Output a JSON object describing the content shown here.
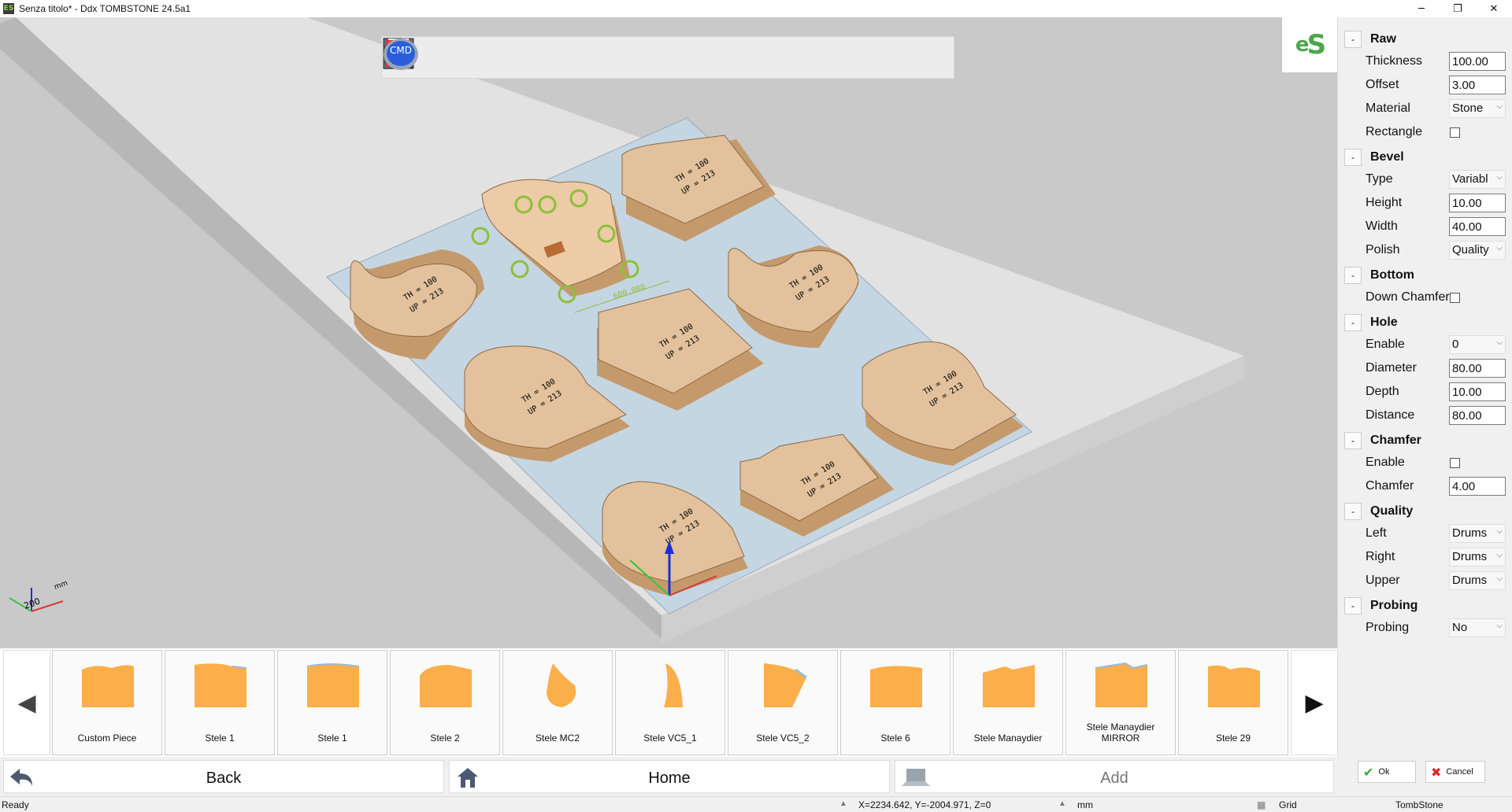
{
  "window": {
    "title": "Senza titolo* - Ddx TOMBSTONE 24.5a1",
    "app_icon": "ES",
    "minimize": "─",
    "restore": "❐",
    "close": "✕"
  },
  "toolbar": {
    "icons": [
      "new-file-icon",
      "open-folder-icon",
      "save-icon",
      "zoom-window-icon",
      "zoom-all-icon",
      "zoom-in-icon",
      "zoom-out-icon",
      "fit-view-icon",
      "rotate-view-icon",
      "view-3d-icon",
      "wireframe-icon",
      "solid-icon",
      "cmd-icon"
    ],
    "cmd_label": "CMD"
  },
  "logo": {
    "text_e": "e",
    "text_s": "S"
  },
  "viewport": {
    "axis_unit": "mm",
    "axis_value": "200",
    "pieces": [
      {
        "line1": "TH = 100",
        "line2": "UP = 213"
      },
      {
        "line1": "TH = 100",
        "line2": "UP = 213"
      },
      {
        "line1": "TH = 100",
        "line2": "UP = 213"
      },
      {
        "line1": "TH = 100",
        "line2": "UP = 213"
      },
      {
        "line1": "TH = 100",
        "line2": "UP = 213"
      },
      {
        "line1": "TH = 100",
        "line2": "UP = 213"
      },
      {
        "line1": "TH = 100",
        "line2": "UP = 213"
      },
      {
        "line1": "TH = 100",
        "line2": "UP = 213"
      }
    ],
    "dimension": "600.000"
  },
  "properties": {
    "raw": {
      "title": "Raw",
      "toggle": "-",
      "thickness_label": "Thickness",
      "thickness": "100.00",
      "offset_label": "Offset",
      "offset": "3.00",
      "material_label": "Material",
      "material": "Stone",
      "rectangle_label": "Rectangle"
    },
    "bevel": {
      "title": "Bevel",
      "toggle": "-",
      "type_label": "Type",
      "type": "Variabl",
      "height_label": "Height",
      "height": "10.00",
      "width_label": "Width",
      "width": "40.00",
      "polish_label": "Polish",
      "polish": "Quality"
    },
    "bottom": {
      "title": "Bottom",
      "toggle": "-",
      "down_chamfer_label": "Down Chamfer"
    },
    "hole": {
      "title": "Hole",
      "toggle": "-",
      "enable_label": "Enable",
      "enable": "0",
      "diameter_label": "Diameter",
      "diameter": "80.00",
      "depth_label": "Depth",
      "depth": "10.00",
      "distance_label": "Distance",
      "distance": "80.00"
    },
    "chamfer": {
      "title": "Chamfer",
      "toggle": "-",
      "enable_label": "Enable",
      "chamfer_label": "Chamfer",
      "chamfer": "4.00"
    },
    "quality": {
      "title": "Quality",
      "toggle": "-",
      "left_label": "Left",
      "left": "Drums",
      "right_label": "Right",
      "right": "Drums",
      "upper_label": "Upper",
      "upper": "Drums"
    },
    "probing": {
      "title": "Probing",
      "toggle": "-",
      "probing_label": "Probing",
      "probing": "No"
    },
    "dropdown_arrow": "⌵"
  },
  "gallery": {
    "prev": "◀",
    "next": "▶",
    "items": [
      "Custom Piece",
      "Stele 1",
      "Stele 1",
      "Stele 2",
      "Stele MC2",
      "Stele VC5_1",
      "Stele VC5_2",
      "Stele 6",
      "Stele Manaydier",
      "Stele Manaydier MIRROR",
      "Stele 29"
    ]
  },
  "nav": {
    "back": "Back",
    "home": "Home",
    "add": "Add"
  },
  "dialog": {
    "ok": "Ok",
    "cancel": "Cancel",
    "ok_icon": "✔",
    "cancel_icon": "✖"
  },
  "status": {
    "ready": "Ready",
    "coords": "X=2234.642, Y=-2004.971, Z=0",
    "unit": "mm",
    "grid": "Grid",
    "mode": "TombStone"
  },
  "colors": {
    "stone": "#e2c19c",
    "stone_side": "#c49a6c",
    "plate": "#c5d6e3",
    "slab": "#e2e2e2",
    "accent": "#4ca64c"
  }
}
